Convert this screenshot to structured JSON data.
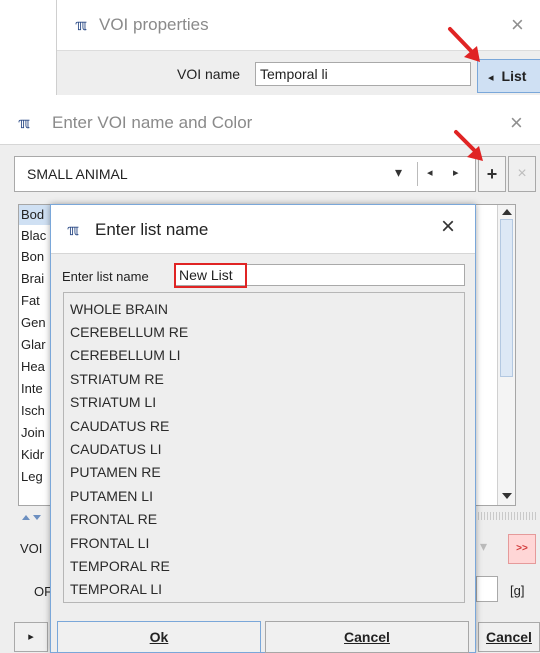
{
  "voi_properties": {
    "title": "VOI properties",
    "name_label": "VOI name",
    "name_value": "Temporal li",
    "list_button": "List",
    "list_arrow": "◂"
  },
  "enter_voi": {
    "title": "Enter VOI name and Color",
    "combo_value": "SMALL ANIMAL",
    "combo_dropdown": "▾",
    "prev_symbol": "◂",
    "next_symbol": "▸",
    "add_symbol": "+",
    "remove_symbol": "×",
    "left_items": [
      "Bod",
      "Blac",
      "Bon",
      "Brai",
      "Fat",
      "Gen",
      "Glar",
      "Hea",
      "Inte",
      "Isch",
      "Join",
      "Kidr",
      "Leg"
    ],
    "voi_label_partial": "VOI",
    "other_label_partial": "OF",
    "unit": "[g]",
    "forward_symbol": ">>",
    "bottom_cancel": "Cancel",
    "bottom_arrow": "▸"
  },
  "dialog": {
    "title": "Enter list name",
    "input_label": "Enter list name",
    "input_value": "New List",
    "items": [
      "WHOLE BRAIN",
      "CEREBELLUM RE",
      "CEREBELLUM LI",
      "STRIATUM RE",
      "STRIATUM LI",
      "CAUDATUS RE",
      "CAUDATUS LI",
      "PUTAMEN RE",
      "PUTAMEN LI",
      "FRONTAL RE",
      "FRONTAL LI",
      "TEMPORAL RE",
      "TEMPORAL LI"
    ],
    "ok_label": "Ok",
    "cancel_label": "Cancel",
    "close_symbol": "×"
  },
  "icons": {
    "app_logo": "pmod-logo-icon",
    "arrow": "red-pointer-arrow-icon"
  },
  "colors": {
    "accent_blue": "#7aa7d9",
    "highlight_red": "#e02424",
    "logo_blue": "#2b4a86"
  }
}
